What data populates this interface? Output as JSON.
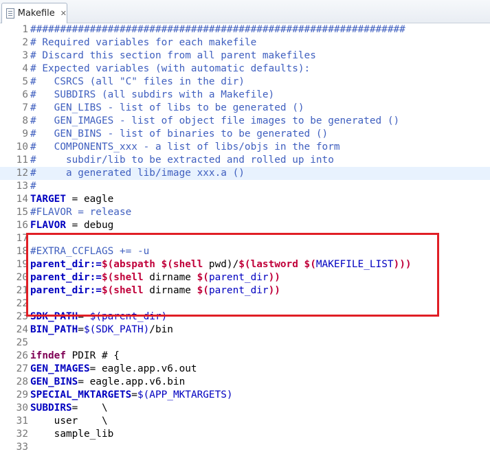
{
  "tab": {
    "title": "Makefile",
    "close_glyph": "✕"
  },
  "colors": {
    "comment": "#3f5fbf",
    "variable": "#0000c0",
    "keyword": "#7f0055",
    "function": "#c0003a",
    "highlight_box": "#e01e25",
    "current_line": "#e8f2fe"
  },
  "current_line": 12,
  "highlighted_lines": [
    19,
    24
  ],
  "lines": [
    {
      "n": "1",
      "tokens": [
        [
          "comment",
          "###############################################################"
        ]
      ]
    },
    {
      "n": "2",
      "tokens": [
        [
          "comment",
          "# Required variables for each makefile"
        ]
      ]
    },
    {
      "n": "3",
      "tokens": [
        [
          "comment",
          "# Discard this section from all parent makefiles"
        ]
      ]
    },
    {
      "n": "4",
      "tokens": [
        [
          "comment",
          "# Expected variables (with automatic defaults):"
        ]
      ]
    },
    {
      "n": "5",
      "tokens": [
        [
          "comment",
          "#   CSRCS (all \"C\" files in the dir)"
        ]
      ]
    },
    {
      "n": "6",
      "tokens": [
        [
          "comment",
          "#   SUBDIRS (all subdirs with a Makefile)"
        ]
      ]
    },
    {
      "n": "7",
      "tokens": [
        [
          "comment",
          "#   GEN_LIBS - list of libs to be generated ()"
        ]
      ]
    },
    {
      "n": "8",
      "tokens": [
        [
          "comment",
          "#   GEN_IMAGES - list of object file images to be generated ()"
        ]
      ]
    },
    {
      "n": "9",
      "tokens": [
        [
          "comment",
          "#   GEN_BINS - list of binaries to be generated ()"
        ]
      ]
    },
    {
      "n": "10",
      "tokens": [
        [
          "comment",
          "#   COMPONENTS_xxx - a list of libs/objs in the form"
        ]
      ]
    },
    {
      "n": "11",
      "tokens": [
        [
          "comment",
          "#     subdir/lib to be extracted and rolled up into"
        ]
      ]
    },
    {
      "n": "12",
      "tokens": [
        [
          "comment",
          "#     a generated lib/image xxx.a ()"
        ]
      ]
    },
    {
      "n": "13",
      "tokens": [
        [
          "comment",
          "#"
        ]
      ]
    },
    {
      "n": "14",
      "tokens": [
        [
          "var",
          "TARGET"
        ],
        [
          "plain",
          " = eagle"
        ]
      ]
    },
    {
      "n": "15",
      "tokens": [
        [
          "comment",
          "#FLAVOR = release"
        ]
      ]
    },
    {
      "n": "16",
      "tokens": [
        [
          "var",
          "FLAVOR"
        ],
        [
          "plain",
          " = debug"
        ]
      ]
    },
    {
      "n": "17",
      "tokens": []
    },
    {
      "n": "18",
      "tokens": [
        [
          "comment",
          "#EXTRA_CCFLAGS += -u"
        ]
      ]
    },
    {
      "n": "19",
      "tokens": [
        [
          "var",
          "parent_dir:="
        ],
        [
          "fn",
          "$(abspath $(shell"
        ],
        [
          "plain",
          " pwd)/"
        ],
        [
          "fn",
          "$(lastword $("
        ],
        [
          "ref",
          "MAKEFILE_LIST"
        ],
        [
          "fn",
          "))"
        ],
        [
          "fn",
          ")"
        ]
      ]
    },
    {
      "n": "20",
      "tokens": [
        [
          "var",
          "parent_dir:="
        ],
        [
          "fn",
          "$(shell"
        ],
        [
          "plain",
          " dirname "
        ],
        [
          "fn",
          "$("
        ],
        [
          "ref",
          "parent_dir"
        ],
        [
          "fn",
          "))"
        ]
      ]
    },
    {
      "n": "21",
      "tokens": [
        [
          "var",
          "parent_dir:="
        ],
        [
          "fn",
          "$(shell"
        ],
        [
          "plain",
          " dirname "
        ],
        [
          "fn",
          "$("
        ],
        [
          "ref",
          "parent_dir"
        ],
        [
          "fn",
          "))"
        ]
      ]
    },
    {
      "n": "22",
      "tokens": []
    },
    {
      "n": "23",
      "tokens": [
        [
          "var",
          "SDK_PATH"
        ],
        [
          "plain",
          "= "
        ],
        [
          "ref",
          "$(parent_dir)"
        ]
      ]
    },
    {
      "n": "24",
      "tokens": [
        [
          "var",
          "BIN_PATH"
        ],
        [
          "plain",
          "="
        ],
        [
          "ref",
          "$(SDK_PATH)"
        ],
        [
          "plain",
          "/bin"
        ]
      ]
    },
    {
      "n": "25",
      "tokens": []
    },
    {
      "n": "26",
      "tokens": [
        [
          "kw",
          "ifndef"
        ],
        [
          "plain",
          " PDIR # {"
        ]
      ]
    },
    {
      "n": "27",
      "tokens": [
        [
          "var",
          "GEN_IMAGES"
        ],
        [
          "plain",
          "= eagle.app.v6.out"
        ]
      ]
    },
    {
      "n": "28",
      "tokens": [
        [
          "var",
          "GEN_BINS"
        ],
        [
          "plain",
          "= eagle.app.v6.bin"
        ]
      ]
    },
    {
      "n": "29",
      "tokens": [
        [
          "var",
          "SPECIAL_MKTARGETS"
        ],
        [
          "plain",
          "="
        ],
        [
          "ref",
          "$(APP_MKTARGETS)"
        ]
      ]
    },
    {
      "n": "30",
      "tokens": [
        [
          "var",
          "SUBDIRS"
        ],
        [
          "plain",
          "=    \\"
        ]
      ]
    },
    {
      "n": "31",
      "tokens": [
        [
          "plain",
          "    user    \\"
        ]
      ]
    },
    {
      "n": "32",
      "tokens": [
        [
          "plain",
          "    sample_lib"
        ]
      ]
    },
    {
      "n": "33",
      "tokens": []
    }
  ]
}
